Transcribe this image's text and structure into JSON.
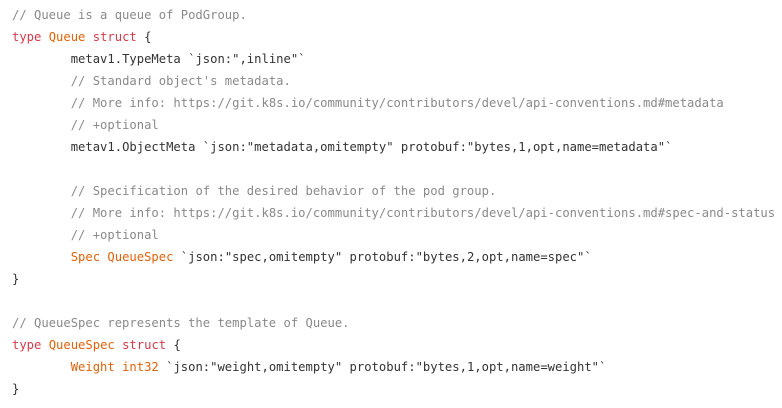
{
  "lines": [
    {
      "indent": "",
      "segments": [
        {
          "cls": "comment",
          "text": "// Queue is a queue of PodGroup."
        }
      ]
    },
    {
      "indent": "",
      "segments": [
        {
          "cls": "kw",
          "text": "type"
        },
        {
          "cls": "plain",
          "text": " "
        },
        {
          "cls": "type",
          "text": "Queue"
        },
        {
          "cls": "plain",
          "text": " "
        },
        {
          "cls": "kw",
          "text": "struct"
        },
        {
          "cls": "plain",
          "text": " {"
        }
      ]
    },
    {
      "indent": "        ",
      "segments": [
        {
          "cls": "plain",
          "text": "metav1.TypeMeta `json:\",inline\"`"
        }
      ]
    },
    {
      "indent": "        ",
      "segments": [
        {
          "cls": "comment",
          "text": "// Standard object's metadata."
        }
      ]
    },
    {
      "indent": "        ",
      "segments": [
        {
          "cls": "comment",
          "text": "// More info: https://git.k8s.io/community/contributors/devel/api-conventions.md#metadata"
        }
      ]
    },
    {
      "indent": "        ",
      "segments": [
        {
          "cls": "comment",
          "text": "// +optional"
        }
      ]
    },
    {
      "indent": "        ",
      "segments": [
        {
          "cls": "plain",
          "text": "metav1.ObjectMeta `json:\"metadata,omitempty\" protobuf:\"bytes,1,opt,name=metadata\"`"
        }
      ]
    },
    {
      "indent": "",
      "segments": []
    },
    {
      "indent": "        ",
      "segments": [
        {
          "cls": "comment",
          "text": "// Specification of the desired behavior of the pod group."
        }
      ]
    },
    {
      "indent": "        ",
      "segments": [
        {
          "cls": "comment",
          "text": "// More info: https://git.k8s.io/community/contributors/devel/api-conventions.md#spec-and-status"
        }
      ]
    },
    {
      "indent": "        ",
      "segments": [
        {
          "cls": "comment",
          "text": "// +optional"
        }
      ]
    },
    {
      "indent": "        ",
      "segments": [
        {
          "cls": "type",
          "text": "Spec"
        },
        {
          "cls": "plain",
          "text": " "
        },
        {
          "cls": "type",
          "text": "QueueSpec"
        },
        {
          "cls": "plain",
          "text": " `json:\"spec,omitempty\" protobuf:\"bytes,2,opt,name=spec\"`"
        }
      ]
    },
    {
      "indent": "",
      "segments": [
        {
          "cls": "plain",
          "text": "}"
        }
      ]
    },
    {
      "indent": "",
      "segments": []
    },
    {
      "indent": "",
      "segments": [
        {
          "cls": "comment",
          "text": "// QueueSpec represents the template of Queue."
        }
      ]
    },
    {
      "indent": "",
      "segments": [
        {
          "cls": "kw",
          "text": "type"
        },
        {
          "cls": "plain",
          "text": " "
        },
        {
          "cls": "type",
          "text": "QueueSpec"
        },
        {
          "cls": "plain",
          "text": " "
        },
        {
          "cls": "kw",
          "text": "struct"
        },
        {
          "cls": "plain",
          "text": " {"
        }
      ]
    },
    {
      "indent": "        ",
      "segments": [
        {
          "cls": "type",
          "text": "Weight"
        },
        {
          "cls": "plain",
          "text": " "
        },
        {
          "cls": "type",
          "text": "int32"
        },
        {
          "cls": "plain",
          "text": " `json:\"weight,omitempty\" protobuf:\"bytes,1,opt,name=weight\"`"
        }
      ]
    },
    {
      "indent": "",
      "segments": [
        {
          "cls": "plain",
          "text": "}"
        }
      ]
    }
  ]
}
